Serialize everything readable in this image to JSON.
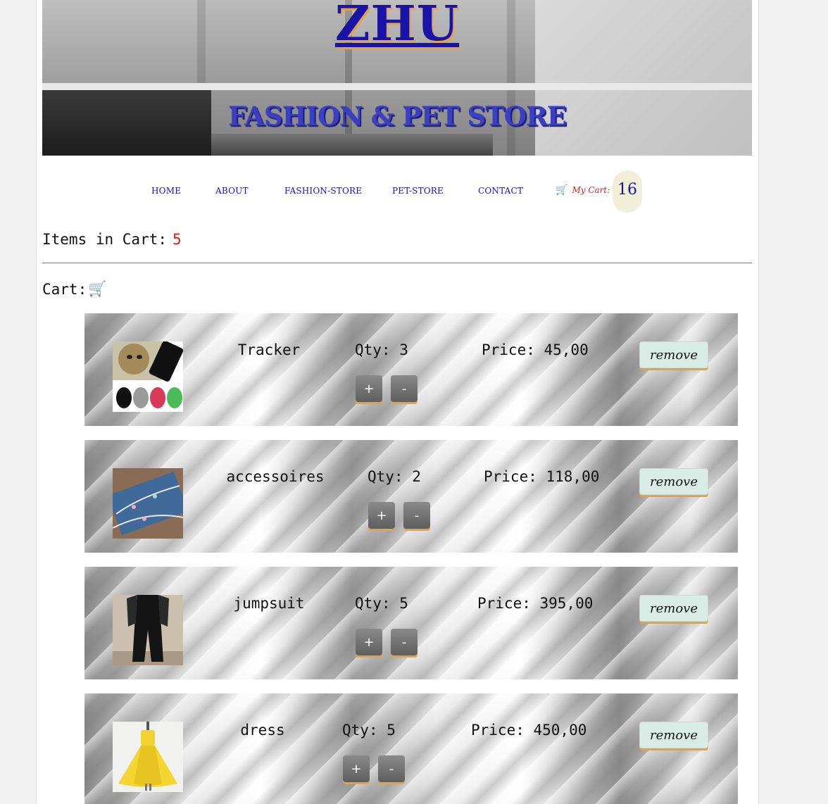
{
  "header": {
    "brand": "ZHU",
    "tagline": "FASHION & PET STORE"
  },
  "nav": {
    "home": "HOME",
    "about": "ABOUT",
    "fashion_store": "FASHION-STORE",
    "pet_store": "PET-STORE",
    "contact": "CONTACT",
    "my_cart_label": "My Cart:",
    "cart_badge": "16",
    "cart_icon": "🛒"
  },
  "summary": {
    "items_label": "Items in Cart:",
    "items_count": "5",
    "cart_title": "Cart:",
    "cart_icon": "🛒"
  },
  "cart": {
    "items": [
      {
        "name": "Tracker",
        "qty_label": "Qty: 3",
        "price_label": "Price: 45,00",
        "plus": "+",
        "minus": "-",
        "remove": "remove",
        "image_icon": "pet-tracker-image"
      },
      {
        "name": "accessoires",
        "qty_label": "Qty: 2",
        "price_label": "Price: 118,00",
        "plus": "+",
        "minus": "-",
        "remove": "remove",
        "image_icon": "bracelet-image"
      },
      {
        "name": "jumpsuit",
        "qty_label": "Qty: 5",
        "price_label": "Price: 395,00",
        "plus": "+",
        "minus": "-",
        "remove": "remove",
        "image_icon": "jumpsuit-image"
      },
      {
        "name": "dress",
        "qty_label": "Qty: 5",
        "price_label": "Price: 450,00",
        "plus": "+",
        "minus": "-",
        "remove": "remove",
        "image_icon": "yellow-dress-image"
      }
    ]
  },
  "colors": {
    "brand_blue": "#1a13a8",
    "accent_orange": "#e6a23c",
    "count_red": "#e0201a"
  }
}
